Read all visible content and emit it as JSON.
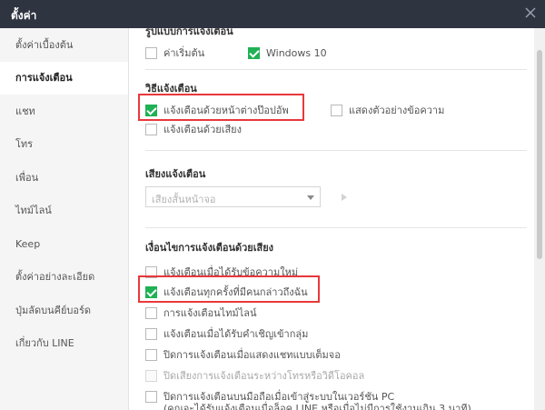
{
  "window": {
    "title": "ตั้งค่า"
  },
  "sidebar": {
    "items": [
      {
        "label": "ตั้งค่าเบื้องต้น"
      },
      {
        "label": "การแจ้งเตือน"
      },
      {
        "label": "แชท"
      },
      {
        "label": "โทร"
      },
      {
        "label": "เพื่อน"
      },
      {
        "label": "ไทม์ไลน์"
      },
      {
        "label": "Keep"
      },
      {
        "label": "ตั้งค่าอย่างละเอียด"
      },
      {
        "label": "ปุ่มลัดบนคีย์บอร์ด"
      },
      {
        "label": "เกี่ยวกับ LINE"
      }
    ]
  },
  "main": {
    "style_section": {
      "title": "รูปแบบการแจ้งเตือน",
      "options": [
        {
          "label": "ค่าเริ่มต้น",
          "checked": false
        },
        {
          "label": "Windows 10",
          "checked": true
        }
      ]
    },
    "method_section": {
      "title": "วิธีแจ้งเตือน",
      "options": [
        {
          "label": "แจ้งเตือนด้วยหน้าต่างป๊อปอัพ",
          "checked": true
        },
        {
          "label": "แสดงตัวอย่างข้อความ",
          "checked": false
        },
        {
          "label": "แจ้งเตือนด้วยเสียง",
          "checked": false
        }
      ]
    },
    "sound_section": {
      "title": "เสียงแจ้งเตือน",
      "select_value": "เสียงสั้นหน้าจอ"
    },
    "condition_section": {
      "title": "เงื่อนไขการแจ้งเตือนด้วยเสียง",
      "options": [
        {
          "label": "แจ้งเตือนเมื่อได้รับข้อความใหม่",
          "checked": false
        },
        {
          "label": "แจ้งเตือนทุกครั้งที่มีคนกล่าวถึงฉัน",
          "checked": true
        },
        {
          "label": "การแจ้งเตือนไทม์ไลน์",
          "checked": false
        },
        {
          "label": "แจ้งเตือนเมื่อได้รับคำเชิญเข้ากลุ่ม",
          "checked": false
        },
        {
          "label": "ปิดการแจ้งเตือนเมื่อแสดงแชทแบบเต็มจอ",
          "checked": false
        },
        {
          "label": "ปิดเสียงการแจ้งเตือนระหว่างโทรหรือวิดีโอคอล",
          "checked": false
        },
        {
          "label": "ปิดการแจ้งเตือนบนมือถือเมื่อเข้าสู่ระบบในเวอร์ชัน PC",
          "checked": false
        }
      ],
      "note": "(คุณจะได้รับแจ้งเตือนเมื่อล็อค LINE หรือเมื่อไม่มีการใช้งานเกิน 3 นาที)"
    }
  },
  "colors": {
    "titlebar": "#2f3441",
    "check_green": "#1fb154",
    "highlight_red": "#e8383b"
  }
}
